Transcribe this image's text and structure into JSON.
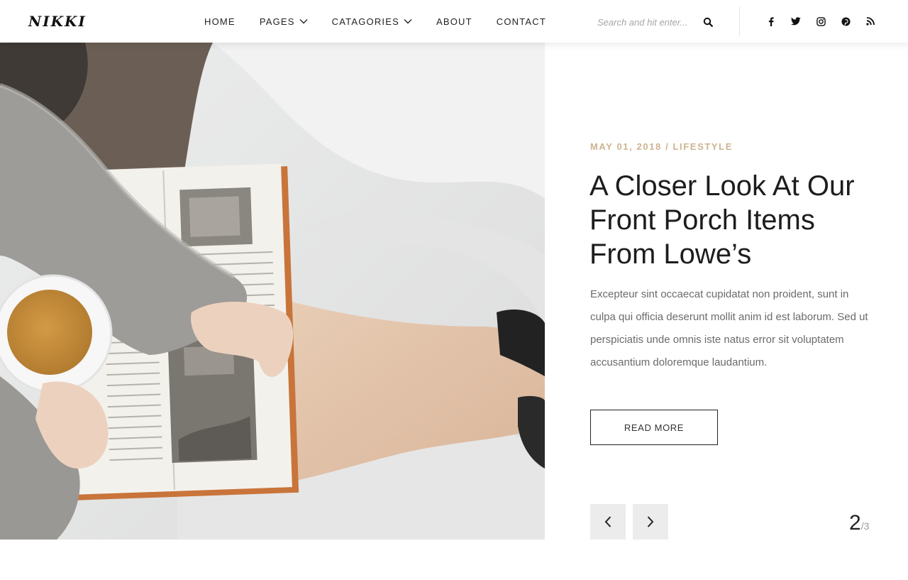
{
  "brand": {
    "logo_text": "NIKKI"
  },
  "nav": {
    "items": [
      {
        "label": "HOME",
        "has_dropdown": false
      },
      {
        "label": "PAGES",
        "has_dropdown": true
      },
      {
        "label": "CATAGORIES",
        "has_dropdown": true
      },
      {
        "label": "ABOUT",
        "has_dropdown": false
      },
      {
        "label": "CONTACT",
        "has_dropdown": false
      }
    ]
  },
  "search": {
    "placeholder": "Search and hit enter...",
    "icon": "search-icon"
  },
  "social": [
    "facebook-icon",
    "twitter-icon",
    "instagram-icon",
    "pinterest-icon",
    "rss-icon"
  ],
  "post": {
    "meta": "MAY 01, 2018 / LIFESTYLE",
    "title": "A Closer Look At Our Front Porch Items From Lowe’s",
    "excerpt": "Excepteur sint occaecat cupidatat non proident, sunt in culpa qui officia deserunt mollit anim id est laborum. Sed ut perspiciatis unde omnis iste natus error sit voluptatem accusantium doloremque laudantium.",
    "read_more_label": "READ MORE"
  },
  "slider": {
    "current": "2",
    "total": "/3"
  },
  "colors": {
    "meta_accent": "#cdb38f",
    "text_dark": "#1d1d1d",
    "arrow_bg": "#ececec"
  }
}
